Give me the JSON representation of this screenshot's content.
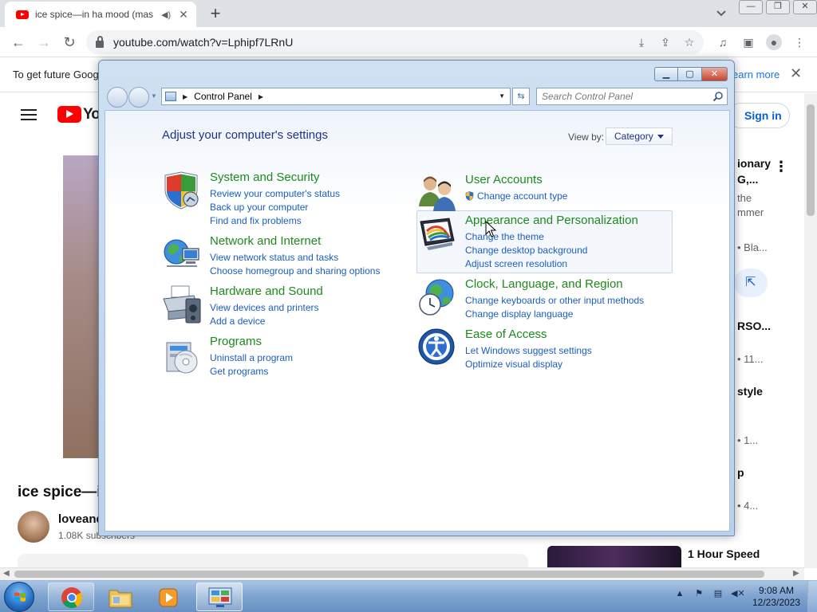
{
  "browser": {
    "tab_title": "ice spice—in ha mood (mas",
    "url": "youtube.com/watch?v=Lphipf7LRnU",
    "new_tab_label": "+",
    "tab_close_glyph": "✕"
  },
  "infobar": {
    "text": "To get future Goog",
    "learn_more": "earn more",
    "close_glyph": "✕"
  },
  "youtube": {
    "wordmark": "Yo",
    "sign_in": "Sign in",
    "video_title": "ice spice—i",
    "channel_name": "loveand",
    "subscribers": "1.08K subscribers",
    "sidebar": [
      {
        "text": "ionary",
        "bold": true
      },
      {
        "text": "G,...",
        "bold": true
      },
      {
        "text": "the",
        "bold": false
      },
      {
        "text": "mmer",
        "bold": false
      },
      {
        "text": "• Bla...",
        "bold": false
      },
      {
        "text": "RSO...",
        "bold": true
      },
      {
        "text": "• 11...",
        "bold": false
      },
      {
        "text": "style",
        "bold": true
      },
      {
        "text": "• 1...",
        "bold": false
      },
      {
        "text": "p",
        "bold": true
      },
      {
        "text": "• 4...",
        "bold": false
      },
      {
        "text": "1 Hour Speed",
        "bold": true
      }
    ]
  },
  "control_panel": {
    "address_crumb": "Control Panel",
    "search_placeholder": "Search Control Panel",
    "heading": "Adjust your computer's settings",
    "view_by_label": "View by:",
    "view_by_value": "Category",
    "categories_left": [
      {
        "title": "System and Security",
        "icon": "shield-icon",
        "links": [
          "Review your computer's status",
          "Back up your computer",
          "Find and fix problems"
        ]
      },
      {
        "title": "Network and Internet",
        "icon": "network-icon",
        "links": [
          "View network status and tasks",
          "Choose homegroup and sharing options"
        ]
      },
      {
        "title": "Hardware and Sound",
        "icon": "printer-icon",
        "links": [
          "View devices and printers",
          "Add a device"
        ]
      },
      {
        "title": "Programs",
        "icon": "programs-icon",
        "links": [
          "Uninstall a program",
          "Get programs"
        ]
      }
    ],
    "categories_right": [
      {
        "title": "User Accounts",
        "icon": "users-icon",
        "links": [
          "Change account type"
        ]
      },
      {
        "title": "Appearance and Personalization",
        "icon": "appearance-icon",
        "links": [
          "Change the theme",
          "Change desktop background",
          "Adjust screen resolution"
        ]
      },
      {
        "title": "Clock, Language, and Region",
        "icon": "clock-globe-icon",
        "links": [
          "Change keyboards or other input methods",
          "Change display language"
        ]
      },
      {
        "title": "Ease of Access",
        "icon": "ease-of-access-icon",
        "links": [
          "Let Windows suggest settings",
          "Optimize visual display"
        ]
      }
    ]
  },
  "taskbar": {
    "time": "9:08 AM",
    "date": "12/23/2023",
    "items": [
      "chrome-icon",
      "explorer-icon",
      "media-player-icon",
      "control-panel-icon"
    ]
  },
  "colors": {
    "category_title": "#1c8a1c",
    "link": "#1c5dbf",
    "heading": "#1e3287"
  }
}
